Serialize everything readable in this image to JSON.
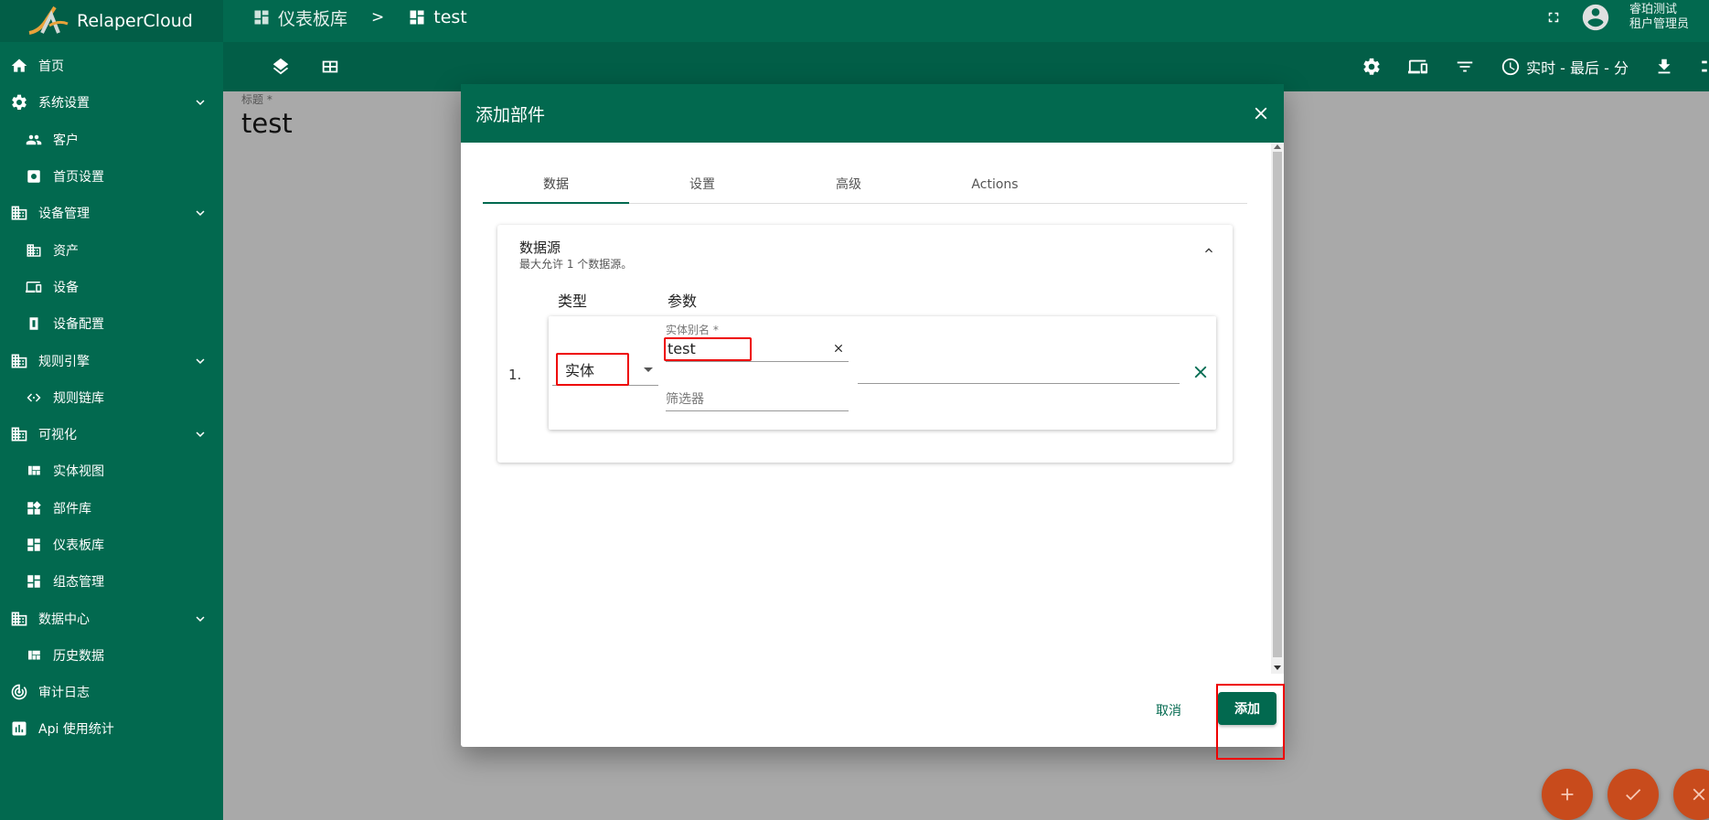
{
  "app": {
    "name": "RelaperCloud"
  },
  "breadcrumb": {
    "items": [
      "仪表板库",
      "test"
    ],
    "separator": ">"
  },
  "user": {
    "name": "睿珀测试",
    "role": "租户管理员"
  },
  "toolbar": {
    "time_window": "实时 - 最后 - 分"
  },
  "sidebar": {
    "items": [
      {
        "label": "首页",
        "icon": "home-icon",
        "level": "top"
      },
      {
        "label": "系统设置",
        "icon": "gear-icon",
        "level": "top",
        "expandable": true
      },
      {
        "label": "客户",
        "icon": "people-icon",
        "level": "sub"
      },
      {
        "label": "首页设置",
        "icon": "settings-box-icon",
        "level": "sub"
      },
      {
        "label": "设备管理",
        "icon": "building-icon",
        "level": "top",
        "expandable": true
      },
      {
        "label": "资产",
        "icon": "building-icon",
        "level": "sub"
      },
      {
        "label": "设备",
        "icon": "devices-icon",
        "level": "sub"
      },
      {
        "label": "设备配置",
        "icon": "device-profile-icon",
        "level": "sub"
      },
      {
        "label": "规则引擎",
        "icon": "building-icon",
        "level": "top",
        "expandable": true
      },
      {
        "label": "规则链库",
        "icon": "code-arrows-icon",
        "level": "sub"
      },
      {
        "label": "可视化",
        "icon": "building-icon",
        "level": "top",
        "expandable": true
      },
      {
        "label": "实体视图",
        "icon": "view-quilt-icon",
        "level": "sub"
      },
      {
        "label": "部件库",
        "icon": "widgets-icon",
        "level": "sub"
      },
      {
        "label": "仪表板库",
        "icon": "dashboard-icon",
        "level": "sub"
      },
      {
        "label": "组态管理",
        "icon": "dashboard-icon",
        "level": "sub"
      },
      {
        "label": "数据中心",
        "icon": "building-icon",
        "level": "top",
        "expandable": true
      },
      {
        "label": "历史数据",
        "icon": "view-quilt-icon",
        "level": "sub"
      },
      {
        "label": "审计日志",
        "icon": "track-changes-icon",
        "level": "top"
      },
      {
        "label": "Api 使用统计",
        "icon": "insert-chart-icon",
        "level": "top"
      }
    ]
  },
  "dashboard": {
    "title_label": "标题 *",
    "title": "test"
  },
  "dialog": {
    "title": "添加部件",
    "tabs": [
      "数据",
      "设置",
      "高级",
      "Actions"
    ],
    "active_tab": 0,
    "datasource": {
      "title": "数据源",
      "subtitle": "最大允许 1 个数据源。",
      "col_type": "类型",
      "col_params": "参数",
      "rows": [
        {
          "index": "1.",
          "type": "实体",
          "alias_label": "实体别名 *",
          "alias": "test",
          "filter_placeholder": "筛选器"
        }
      ]
    },
    "cancel_label": "取消",
    "add_label": "添加"
  },
  "colors": {
    "primary": "#02694f",
    "fab": "#c84b1c",
    "highlight": "#e00000"
  }
}
